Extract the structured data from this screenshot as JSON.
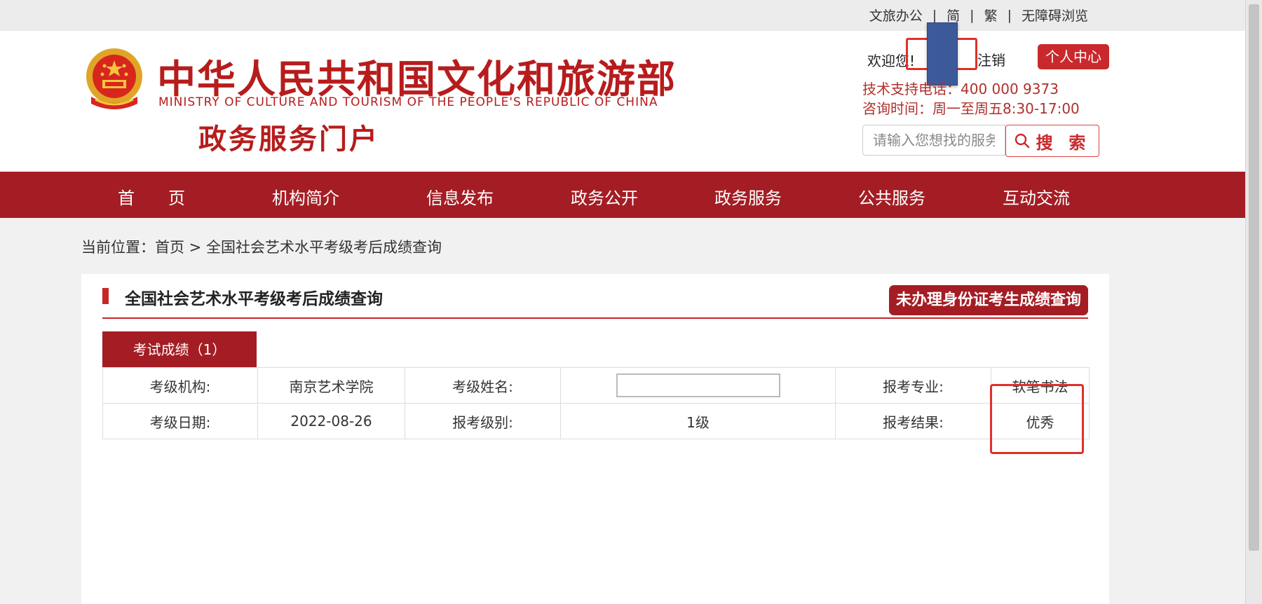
{
  "top_links": [
    "文旅办公",
    "简",
    "繁",
    "无障碍浏览"
  ],
  "logo": {
    "title_cn": "中华人民共和国文化和旅游部",
    "title_en": "MINISTRY OF CULTURE AND TOURISM OF THE PEOPLE'S REPUBLIC OF CHINA",
    "subtitle": "政务服务门户"
  },
  "user": {
    "welcome": "欢迎您!",
    "logout": "注销",
    "personal_center": "个人中心"
  },
  "support": {
    "phone": "技术支持电话：400 000 9373",
    "hours": "咨询时间：周一至周五8:30-17:00"
  },
  "search": {
    "placeholder": "请输入您想找的服务",
    "button_label": "搜 索"
  },
  "nav": [
    "首　　页",
    "机构简介",
    "信息发布",
    "政务公开",
    "政务服务",
    "公共服务",
    "互动交流"
  ],
  "breadcrumb": {
    "prefix": "当前位置：",
    "home": "首页",
    "separator": " > ",
    "current": "全国社会艺术水平考级考后成绩查询"
  },
  "panel": {
    "title": "全国社会艺术水平考级考后成绩查询",
    "no_id_button": "未办理身份证考生成绩查询",
    "tab_label": "考试成绩（1）"
  },
  "result": {
    "row1": {
      "org_label": "考级机构:",
      "org_value": "南京艺术学院",
      "name_label": "考级姓名:",
      "name_value": "",
      "major_label": "报考专业:",
      "major_value": "软笔书法"
    },
    "row2": {
      "date_label": "考级日期:",
      "date_value": "2022-08-26",
      "level_label": "报考级别:",
      "level_value": "1级",
      "result_label": "报考结果:",
      "result_value": "优秀"
    }
  },
  "colors": {
    "brand_red": "#a41d24",
    "logo_red": "#b71c1c",
    "annotation_red": "#e0302a"
  },
  "icons": [
    "national-emblem-icon",
    "search-icon"
  ]
}
